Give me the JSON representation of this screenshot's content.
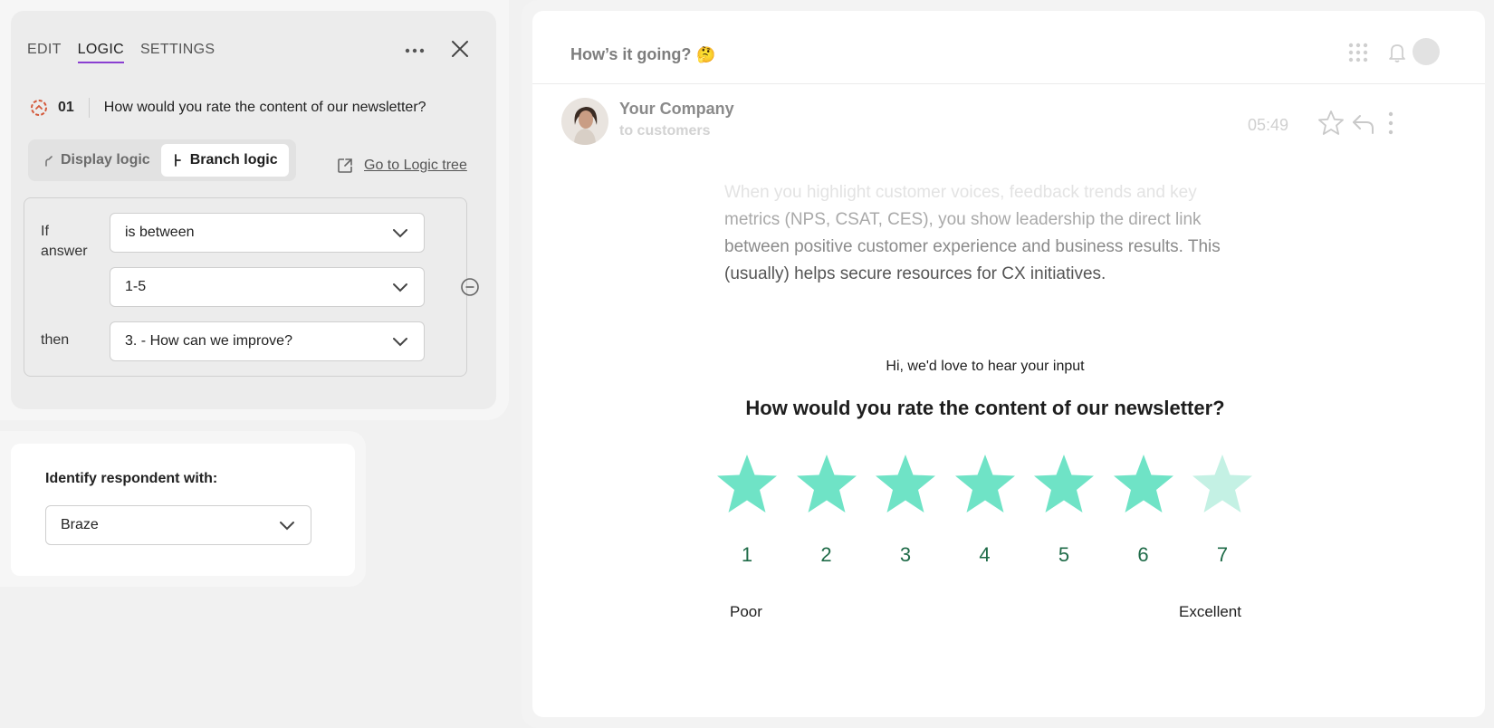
{
  "logic_panel": {
    "tabs": [
      {
        "label": "EDIT",
        "active": false
      },
      {
        "label": "LOGIC",
        "active": true
      },
      {
        "label": "SETTINGS",
        "active": false
      }
    ],
    "question_number": "01",
    "question_text": "How would you rate the content of our newsletter?",
    "segment": {
      "display": "Display logic",
      "branch": "Branch logic",
      "active": "Branch logic"
    },
    "goto_link": "Go to Logic tree",
    "rule": {
      "if_label": "If answer",
      "then_label": "then",
      "condition": "is between",
      "range": "1-5",
      "target": "3. - How can we improve?"
    }
  },
  "identify": {
    "title": "Identify respondent with:",
    "value": "Braze"
  },
  "preview": {
    "subject": "How’s it going?",
    "subject_emoji": "🤔",
    "sender_name": "Your Company",
    "sender_to": "to customers",
    "time": "05:49",
    "body_lines": [
      "When you highlight customer voices, feedback trends and key",
      "metrics (NPS, CSAT, CES), you show leadership the direct link",
      "between positive customer experience and business results. This",
      "(usually) helps secure resources for CX initiatives."
    ],
    "greeting": "Hi, we'd love to hear your input",
    "question": "How would you rate the content of our newsletter?",
    "scale": [
      "1",
      "2",
      "3",
      "4",
      "5",
      "6",
      "7"
    ],
    "selected_rating": 6,
    "low_label": "Poor",
    "high_label": "Excellent"
  },
  "colors": {
    "accent_tab": "#8a3fd1",
    "star_filled": "#6fe3c6",
    "star_empty": "#c4f1e4",
    "scale_number": "#1f6b48"
  }
}
